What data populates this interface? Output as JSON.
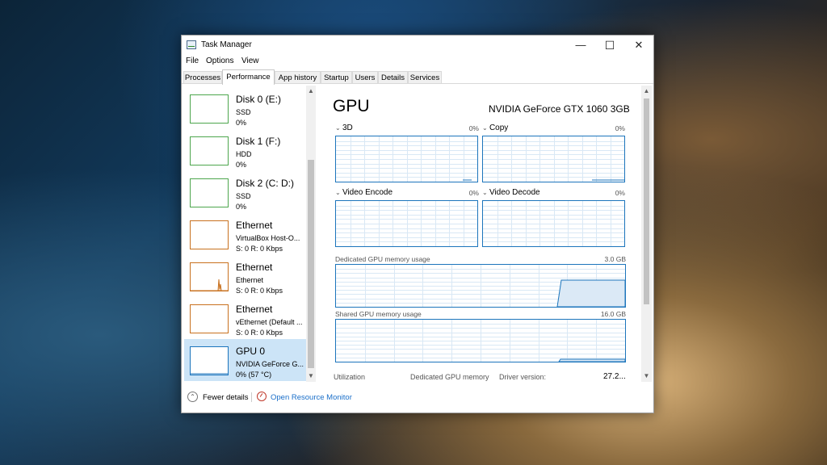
{
  "window": {
    "title": "Task Manager",
    "controls": {
      "minimize": "—",
      "maximize": "☐",
      "close": "✕"
    }
  },
  "menu": [
    "File",
    "Options",
    "View"
  ],
  "tabs": [
    "Processes",
    "Performance",
    "App history",
    "Startup",
    "Users",
    "Details",
    "Services"
  ],
  "active_tab": "Performance",
  "sidebar": [
    {
      "title": "Disk 0 (E:)",
      "sub": "SSD",
      "value": "0%",
      "color": "#4da64d"
    },
    {
      "title": "Disk 1 (F:)",
      "sub": "HDD",
      "value": "0%",
      "color": "#4da64d"
    },
    {
      "title": "Disk 2 (C: D:)",
      "sub": "SSD",
      "value": "0%",
      "color": "#4da64d"
    },
    {
      "title": "Ethernet",
      "sub": "VirtualBox Host-O...",
      "value": "S: 0 R: 0 Kbps",
      "color": "#c8711f"
    },
    {
      "title": "Ethernet",
      "sub": "Ethernet",
      "value": "S: 0 R: 0 Kbps",
      "color": "#c8711f"
    },
    {
      "title": "Ethernet",
      "sub": "vEthernet (Default ...",
      "value": "S: 0 R: 0 Kbps",
      "color": "#c8711f"
    },
    {
      "title": "GPU 0",
      "sub": "NVIDIA GeForce G...",
      "value": "0% (57 °C)",
      "color": "#1c75bc",
      "selected": true
    }
  ],
  "main": {
    "title": "GPU",
    "gpu_name": "NVIDIA GeForce GTX 1060 3GB",
    "engines": [
      {
        "label": "3D",
        "percent": "0%"
      },
      {
        "label": "Copy",
        "percent": "0%"
      },
      {
        "label": "Video Encode",
        "percent": "0%"
      },
      {
        "label": "Video Decode",
        "percent": "0%"
      }
    ],
    "dedicated": {
      "label": "Dedicated GPU memory usage",
      "max": "3.0 GB"
    },
    "shared": {
      "label": "Shared GPU memory usage",
      "max": "16.0 GB"
    },
    "stats": [
      {
        "label": "Utilization"
      },
      {
        "label": "Dedicated GPU memory"
      },
      {
        "label": "Driver version:",
        "value": "27.2..."
      }
    ]
  },
  "footer": {
    "fewer_details": "Fewer details",
    "open_resource_monitor": "Open Resource Monitor"
  },
  "colors": {
    "accent": "#1c75bc",
    "disk": "#4da64d",
    "network": "#c8711f",
    "selected_bg": "#cce4f7",
    "link": "#1a6fc9"
  },
  "icons": [
    "task-manager-icon",
    "chevron-down-icon",
    "chevron-up-icon",
    "resource-monitor-icon"
  ]
}
